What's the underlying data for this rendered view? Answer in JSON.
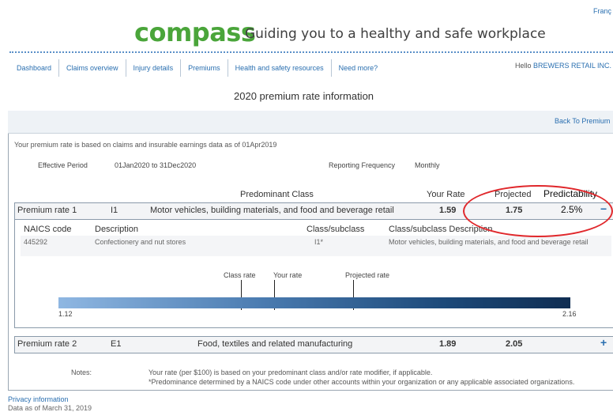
{
  "header": {
    "language_link": "Franç",
    "logo": "compass",
    "tagline": "Guiding you to a healthy and safe workplace"
  },
  "nav": {
    "items": [
      "Dashboard",
      "Claims overview",
      "Injury details",
      "Premiums",
      "Health and safety resources",
      "Need more?"
    ]
  },
  "greeting": {
    "prefix": "Hello ",
    "company": "BREWERS RETAIL INC."
  },
  "page_title": "2020 premium rate information",
  "panel": {
    "back_link": "Back To Premium",
    "basis_text": "Your premium rate is based on claims and insurable earnings data as of 01Apr2019",
    "effective_period_label": "Effective Period",
    "effective_period_value": "01Jan2020 to 31Dec2020",
    "reporting_frequency_label": "Reporting Frequency",
    "reporting_frequency_value": "Monthly"
  },
  "table_headers": {
    "predominant_class": "Predominant Class",
    "your_rate": "Your Rate",
    "projected": "Projected",
    "predictability": "Predictability"
  },
  "rate1": {
    "label": "Premium rate 1",
    "class_code": "I1",
    "description": "Motor vehicles, building materials, and food and beverage retail",
    "your_rate": "1.59",
    "projected": "1.75",
    "predictability": "2.5%",
    "toggle": "−",
    "naics_header": "NAICS code",
    "desc_header": "Description",
    "class_header": "Class/subclass",
    "class_desc_header": "Class/subclass Description",
    "naics_code": "445292",
    "naics_description": "Confectionery and nut stores",
    "class_subclass": "I1*",
    "class_subclass_description": "Motor vehicles, building materials, and food and beverage retail",
    "scale": {
      "min_label": "1.12",
      "max_label": "2.16",
      "class_rate_label": "Class rate",
      "your_rate_label": "Your rate",
      "projected_rate_label": "Projected rate",
      "min": 1.12,
      "max": 2.16,
      "your_rate": 1.59,
      "projected_rate": 1.75
    }
  },
  "rate2": {
    "label": "Premium rate 2",
    "class_code": "E1",
    "description": "Food, textiles and related manufacturing",
    "your_rate": "1.89",
    "projected": "2.05",
    "toggle": "+"
  },
  "notes": {
    "label": "Notes:",
    "line1": "Your rate (per $100) is based on your predominant class and/or rate modifier, if applicable.",
    "line2": "*Predominance determined by a NAICS code under other accounts within your organization or any applicable associated organizations."
  },
  "footer": {
    "privacy": "Privacy information",
    "data_date": "Data as of March 31, 2019"
  },
  "colors": {
    "brand_green": "#4aa53a",
    "link_blue": "#2a6fb0",
    "annotation_red": "#e0282c"
  }
}
